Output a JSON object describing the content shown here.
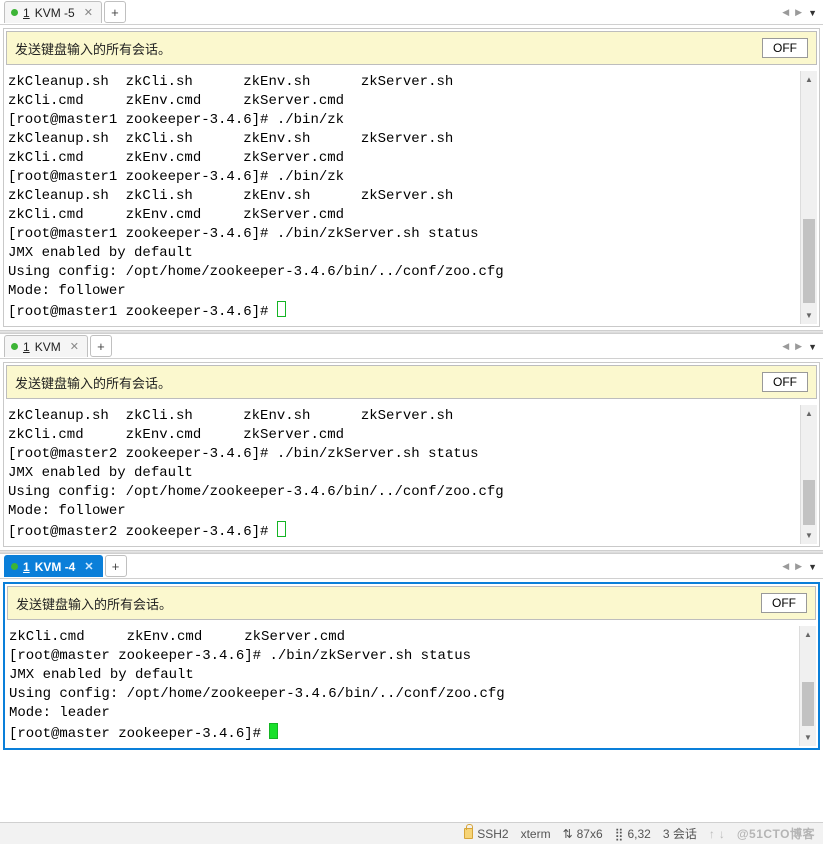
{
  "notice_text": "发送键盘输入的所有会话。",
  "off_label": "OFF",
  "panes": [
    {
      "tab_number": "1",
      "tab_label": "KVM -5",
      "active": false,
      "lines": [
        "zkCleanup.sh  zkCli.sh      zkEnv.sh      zkServer.sh",
        "zkCli.cmd     zkEnv.cmd     zkServer.cmd",
        "[root@master1 zookeeper-3.4.6]# ./bin/zk",
        "zkCleanup.sh  zkCli.sh      zkEnv.sh      zkServer.sh",
        "zkCli.cmd     zkEnv.cmd     zkServer.cmd",
        "[root@master1 zookeeper-3.4.6]# ./bin/zk",
        "zkCleanup.sh  zkCli.sh      zkEnv.sh      zkServer.sh",
        "zkCli.cmd     zkEnv.cmd     zkServer.cmd",
        "[root@master1 zookeeper-3.4.6]# ./bin/zkServer.sh status",
        "JMX enabled by default",
        "Using config: /opt/home/zookeeper-3.4.6/bin/../conf/zoo.cfg",
        "Mode: follower",
        "[root@master1 zookeeper-3.4.6]# "
      ]
    },
    {
      "tab_number": "1",
      "tab_label": "KVM",
      "active": false,
      "lines": [
        "zkCleanup.sh  zkCli.sh      zkEnv.sh      zkServer.sh",
        "zkCli.cmd     zkEnv.cmd     zkServer.cmd",
        "[root@master2 zookeeper-3.4.6]# ./bin/zkServer.sh status",
        "JMX enabled by default",
        "Using config: /opt/home/zookeeper-3.4.6/bin/../conf/zoo.cfg",
        "Mode: follower",
        "[root@master2 zookeeper-3.4.6]# "
      ]
    },
    {
      "tab_number": "1",
      "tab_label": "KVM -4",
      "active": true,
      "lines": [
        "zkCli.cmd     zkEnv.cmd     zkServer.cmd",
        "[root@master zookeeper-3.4.6]# ./bin/zkServer.sh status",
        "JMX enabled by default",
        "Using config: /opt/home/zookeeper-3.4.6/bin/../conf/zoo.cfg",
        "Mode: leader",
        "[root@master zookeeper-3.4.6]# "
      ]
    }
  ],
  "status": {
    "proto": "SSH2",
    "term": "xterm",
    "size_icon": "⇅",
    "size": "87x6",
    "pos_icon": "⣿",
    "pos": "6,32",
    "sessions": "3 会话",
    "watermark": "@51CTO博客"
  }
}
